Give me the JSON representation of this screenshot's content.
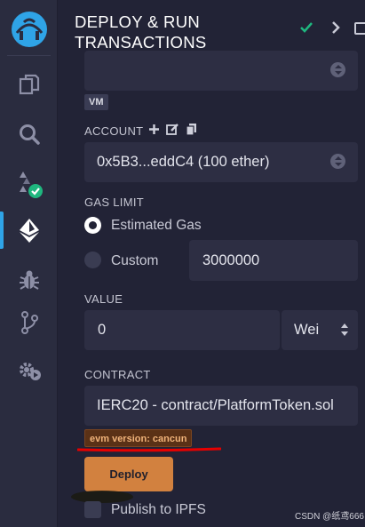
{
  "header": {
    "title": "DEPLOY & RUN TRANSACTIONS"
  },
  "rail": {
    "items": [
      {
        "icon": "remix-logo-icon"
      },
      {
        "icon": "file-explorer-icon"
      },
      {
        "icon": "search-icon"
      },
      {
        "icon": "solidity-compiler-icon"
      },
      {
        "icon": "deploy-run-icon"
      },
      {
        "icon": "debugger-icon"
      },
      {
        "icon": "git-icon"
      },
      {
        "icon": "plugin-settings-icon"
      }
    ]
  },
  "environment": {
    "value": "",
    "badge": "VM"
  },
  "account": {
    "label": "ACCOUNT",
    "value": "0x5B3...eddC4 (100 ether)"
  },
  "gas_limit": {
    "label": "GAS LIMIT",
    "options": [
      {
        "label": "Estimated Gas",
        "checked": true
      },
      {
        "label": "Custom",
        "checked": false
      }
    ],
    "custom_value": "3000000"
  },
  "value": {
    "label": "VALUE",
    "amount": "0",
    "unit": "Wei"
  },
  "contract": {
    "label": "CONTRACT",
    "selected": "IERC20 - contract/PlatformToken.sol",
    "evm_badge": "evm version: cancun"
  },
  "deploy": {
    "label": "Deploy"
  },
  "publish": {
    "label": "Publish to IPFS",
    "checked": false
  },
  "watermark": "CSDN @纸鸢666",
  "colors": {
    "accent": "#2fa4e7",
    "deploy": "#d2813f",
    "success": "#1fb77f",
    "annotation": "#e60000"
  }
}
